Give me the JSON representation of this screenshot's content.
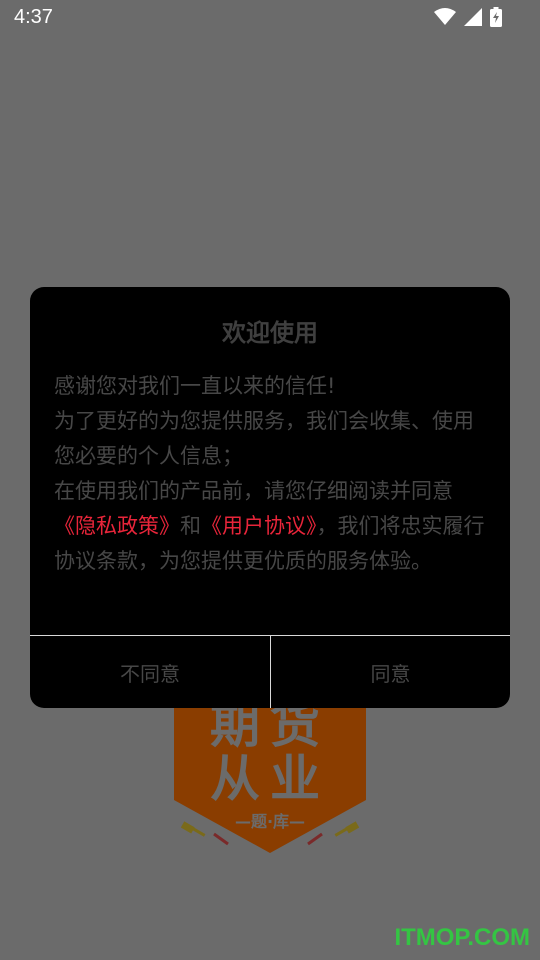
{
  "status_bar": {
    "time": "4:37",
    "icons": [
      "wifi-icon",
      "cellular-signal-icon",
      "battery-charging-icon"
    ]
  },
  "background_logo": {
    "line1": "期货",
    "line2": "从业",
    "subtitle": "—题·库—",
    "color": "#8a3d00"
  },
  "dialog": {
    "title": "欢迎使用",
    "body": {
      "line1": "感谢您对我们一直以来的信任!",
      "line2": "为了更好的为您提供服务，我们会收集、使用您必要的个人信息；",
      "line3_prefix": "在使用我们的产品前，请您仔细阅读并同意",
      "privacy_link": "《隐私政策》",
      "conjunction": "和",
      "agreement_link": "《用户协议》",
      "line3_suffix": "，我们将忠实履行协议条款，为您提供更优质的服务体验。"
    },
    "buttons": {
      "decline": "不同意",
      "accept": "同意"
    },
    "link_color": "#e8253a"
  },
  "watermark": "ITMOP.COM"
}
